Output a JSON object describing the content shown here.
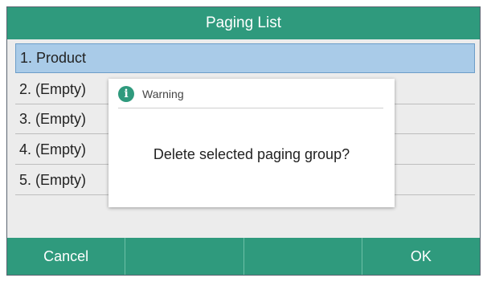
{
  "title_bar": {
    "title": "Paging List"
  },
  "list": {
    "items": [
      {
        "label": "1. Product",
        "selected": true
      },
      {
        "label": "2. (Empty)",
        "selected": false
      },
      {
        "label": "3. (Empty)",
        "selected": false
      },
      {
        "label": "4. (Empty)",
        "selected": false
      },
      {
        "label": "5. (Empty)",
        "selected": false
      }
    ]
  },
  "dialog": {
    "title": "Warning",
    "icon": "info-icon",
    "icon_glyph": "i",
    "message": "Delete selected paging group?"
  },
  "softkeys": {
    "key1": "Cancel",
    "key2": "",
    "key3": "",
    "key4": "OK"
  },
  "colors": {
    "accent": "#2f9a7d",
    "selected_row": "#a9cbe8",
    "screen_bg": "#ececec"
  }
}
